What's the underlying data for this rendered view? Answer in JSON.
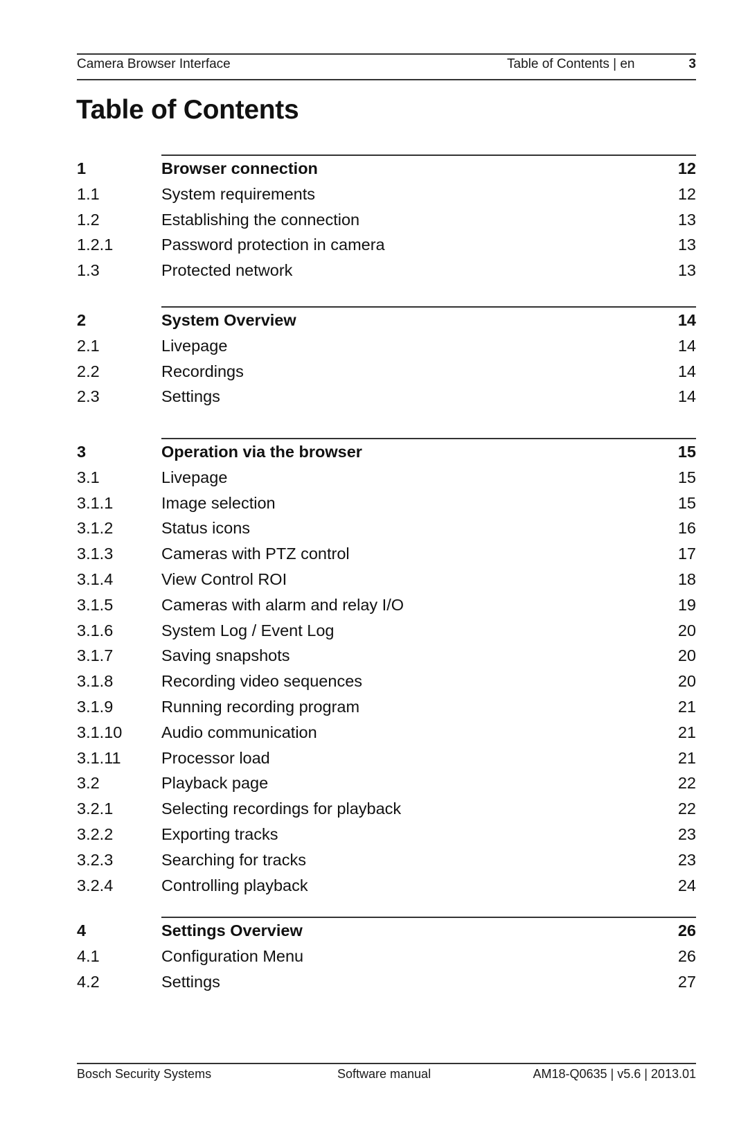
{
  "header": {
    "document_title": "Camera Browser Interface",
    "section_label": "Table of Contents | en",
    "page_number": "3"
  },
  "page_title": "Table of Contents",
  "toc": {
    "sections": [
      {
        "number": "1",
        "title": "Browser connection",
        "page": "12",
        "entries": [
          {
            "number": "1.1",
            "title": "System requirements",
            "page": "12"
          },
          {
            "number": "1.2",
            "title": "Establishing the connection",
            "page": "13"
          },
          {
            "number": "1.2.1",
            "title": "Password protection in camera",
            "page": "13"
          },
          {
            "number": "1.3",
            "title": "Protected network",
            "page": "13"
          }
        ]
      },
      {
        "number": "2",
        "title": "System Overview",
        "page": "14",
        "entries": [
          {
            "number": "2.1",
            "title": "Livepage",
            "page": "14"
          },
          {
            "number": "2.2",
            "title": "Recordings",
            "page": "14"
          },
          {
            "number": "2.3",
            "title": "Settings",
            "page": "14"
          }
        ]
      },
      {
        "number": "3",
        "title": "Operation via the browser",
        "page": "15",
        "entries": [
          {
            "number": "3.1",
            "title": "Livepage",
            "page": "15"
          },
          {
            "number": "3.1.1",
            "title": "Image selection",
            "page": "15"
          },
          {
            "number": "3.1.2",
            "title": "Status icons",
            "page": "16"
          },
          {
            "number": "3.1.3",
            "title": "Cameras with PTZ control",
            "page": "17"
          },
          {
            "number": "3.1.4",
            "title": "View Control ROI",
            "page": "18"
          },
          {
            "number": "3.1.5",
            "title": "Cameras with alarm and relay I/O",
            "page": "19"
          },
          {
            "number": "3.1.6",
            "title": "System Log / Event Log",
            "page": "20"
          },
          {
            "number": "3.1.7",
            "title": "Saving snapshots",
            "page": "20"
          },
          {
            "number": "3.1.8",
            "title": "Recording video sequences",
            "page": "20"
          },
          {
            "number": "3.1.9",
            "title": "Running recording program",
            "page": "21"
          },
          {
            "number": "3.1.10",
            "title": "Audio communication",
            "page": "21"
          },
          {
            "number": "3.1.11",
            "title": "Processor load",
            "page": "21"
          },
          {
            "number": "3.2",
            "title": "Playback page",
            "page": "22"
          },
          {
            "number": "3.2.1",
            "title": "Selecting recordings for playback",
            "page": "22"
          },
          {
            "number": "3.2.2",
            "title": "Exporting tracks",
            "page": "23"
          },
          {
            "number": "3.2.3",
            "title": "Searching for tracks",
            "page": "23"
          },
          {
            "number": "3.2.4",
            "title": "Controlling playback",
            "page": "24"
          }
        ]
      },
      {
        "number": "4",
        "title": "Settings Overview",
        "page": "26",
        "entries": [
          {
            "number": "4.1",
            "title": "Configuration Menu",
            "page": "26"
          },
          {
            "number": "4.2",
            "title": "Settings",
            "page": "27"
          }
        ]
      }
    ]
  },
  "footer": {
    "company": "Bosch Security Systems",
    "doc_type": "Software manual",
    "doc_id": "AM18-Q0635 | v5.6 | 2013.01"
  }
}
